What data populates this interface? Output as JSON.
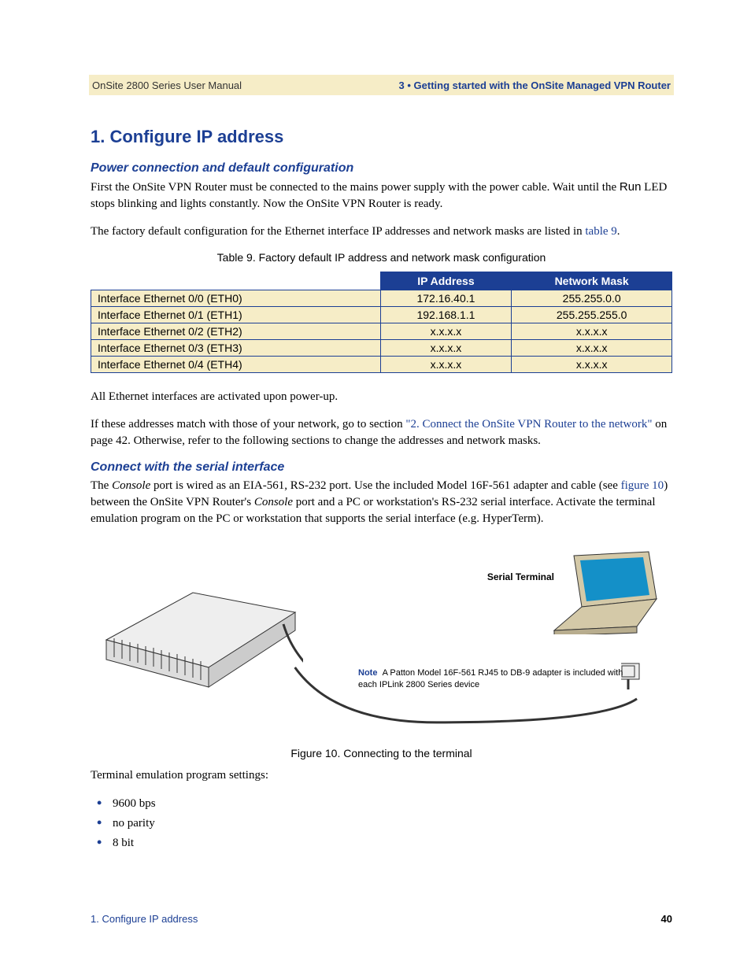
{
  "header": {
    "left": "OnSite 2800 Series User Manual",
    "right": "3 • Getting started with the OnSite Managed VPN Router"
  },
  "h1": "1. Configure IP address",
  "section1": {
    "heading": "Power connection and default configuration",
    "para1a": "First the OnSite VPN Router must be connected to the mains power supply with the power cable. Wait until the ",
    "para1b": "Run",
    "para1c": " LED stops blinking and lights constantly. Now the OnSite VPN Router is ready.",
    "para2a": "The factory default configuration for the Ethernet interface IP addresses and network masks are listed in ",
    "para2b": "table 9",
    "para2c": "."
  },
  "table": {
    "caption": "Table 9. Factory default IP address and network mask configuration",
    "headers": [
      "",
      "IP Address",
      "Network Mask"
    ],
    "rows": [
      [
        "Interface Ethernet 0/0 (ETH0)",
        "172.16.40.1",
        "255.255.0.0"
      ],
      [
        "Interface Ethernet 0/1 (ETH1)",
        "192.168.1.1",
        "255.255.255.0"
      ],
      [
        "Interface Ethernet 0/2 (ETH2)",
        "x.x.x.x",
        "x.x.x.x"
      ],
      [
        "Interface Ethernet 0/3 (ETH3)",
        "x.x.x.x",
        "x.x.x.x"
      ],
      [
        "Interface Ethernet 0/4 (ETH4)",
        "x.x.x.x",
        "x.x.x.x"
      ]
    ]
  },
  "after_table": {
    "para1": "All Ethernet interfaces are activated upon power-up.",
    "para2a": "If these addresses match with those of your network, go to section ",
    "para2b": "\"2. Connect the OnSite VPN Router to the network\"",
    "para2c": " on page 42. Otherwise, refer to the following sections to change the addresses and network masks."
  },
  "section2": {
    "heading": "Connect with the serial interface",
    "para_a": "The ",
    "para_b": "Console",
    "para_c": " port is wired as an EIA-561, RS-232 port. Use the included Model 16F-561 adapter and cable (see ",
    "para_d": "figure 10",
    "para_e": ") between the OnSite VPN Router's ",
    "para_f": "Console",
    "para_g": " port and a PC or workstation's RS-232 serial interface. Activate the terminal emulation program on the PC or workstation that supports the serial interface (e.g. HyperTerm)."
  },
  "figure": {
    "serial_label": "Serial Terminal",
    "note_label": "Note",
    "note_text": "A Patton Model 16F-561 RJ45 to DB-9 adapter is included with each IPLink 2800 Series device",
    "caption": "Figure 10. Connecting to the terminal"
  },
  "settings": {
    "intro": "Terminal emulation program settings:",
    "items": [
      "9600 bps",
      "no parity",
      "8 bit"
    ]
  },
  "footer": {
    "left": "1. Configure IP address",
    "right": "40"
  }
}
